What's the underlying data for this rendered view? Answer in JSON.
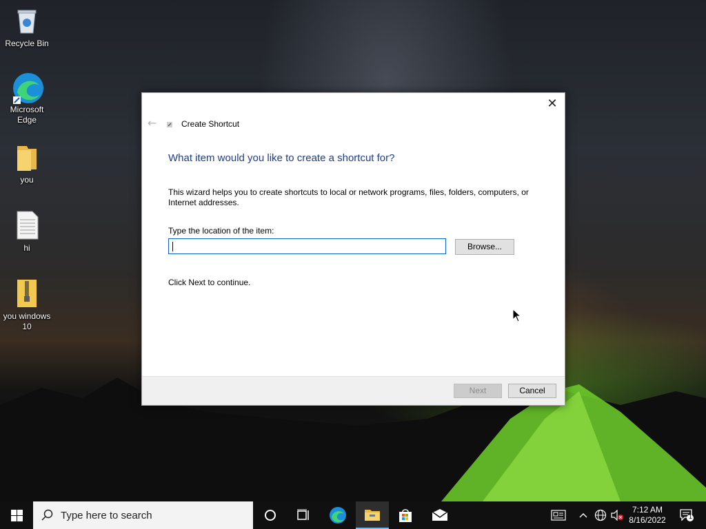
{
  "desktop": {
    "icons": [
      {
        "label": "Recycle Bin",
        "icon": "recycle-bin-icon"
      },
      {
        "label": "Microsoft Edge",
        "icon": "edge-icon"
      },
      {
        "label": "you",
        "icon": "folder-icon"
      },
      {
        "label": "hi",
        "icon": "text-file-icon"
      },
      {
        "label": "you windows 10",
        "icon": "zip-folder-icon"
      }
    ]
  },
  "dialog": {
    "window_title": "Create Shortcut",
    "heading": "What item would you like to create a shortcut for?",
    "description": "This wizard helps you to create shortcuts to local or network programs, files, folders, computers, or Internet addresses.",
    "field_label": "Type the location of the item:",
    "location_value": "",
    "browse_label": "Browse...",
    "hint": "Click Next to continue.",
    "next_label": "Next",
    "cancel_label": "Cancel",
    "next_enabled": false,
    "heading_color": "#1d3c8a"
  },
  "taskbar": {
    "search_placeholder": "Type here to search",
    "pinned": [
      "cortana-icon",
      "task-view-icon",
      "edge-icon",
      "file-explorer-icon",
      "store-icon",
      "mail-icon"
    ],
    "active_app": "file-explorer-icon",
    "clock": {
      "time": "7:12 AM",
      "date": "8/16/2022"
    },
    "notification_count": "1",
    "tray_icons": [
      "news-icon",
      "chevron-up-icon",
      "network-icon",
      "volume-muted-icon",
      "notification-icon"
    ]
  }
}
